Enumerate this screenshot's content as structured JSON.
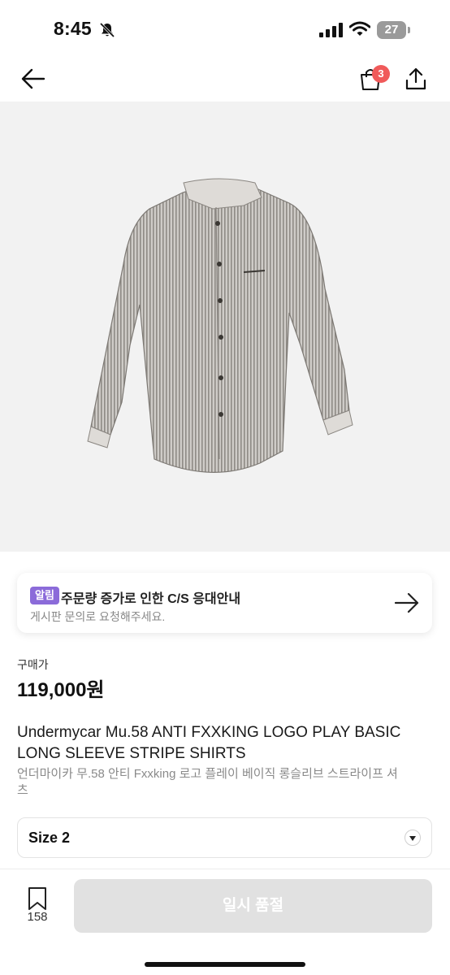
{
  "status_bar": {
    "time": "8:45",
    "battery": "27"
  },
  "header": {
    "cart_badge": "3"
  },
  "notice": {
    "tag": "알림",
    "title": "주문량 증가로 인한 C/S 응대안내",
    "subtitle": "게시판 문의로 요청해주세요."
  },
  "price": {
    "label": "구매가",
    "value": "119,000원"
  },
  "product": {
    "title_en": "Undermycar Mu.58 ANTI FXXKING LOGO PLAY BASIC LONG SLEEVE STRIPE SHIRTS",
    "title_ko": "언더마이카 무.58 안티 Fxxking 로고 플레이 베이직 롱슬리브 스트라이프 셔츠"
  },
  "size_selector": {
    "value": "Size 2"
  },
  "bottom_bar": {
    "bookmark_count": "158",
    "action_label": "일시 품절"
  },
  "colors": {
    "notice_tag": "#8b6bd9",
    "badge": "#f05a5a",
    "disabled_button": "#e1e1e1"
  },
  "icons": [
    "bell-slash-icon",
    "signal-icon",
    "wifi-icon",
    "battery-icon",
    "back-arrow-icon",
    "shopping-bag-icon",
    "share-icon",
    "arrow-right-icon",
    "chevron-down-icon",
    "bookmark-icon"
  ]
}
